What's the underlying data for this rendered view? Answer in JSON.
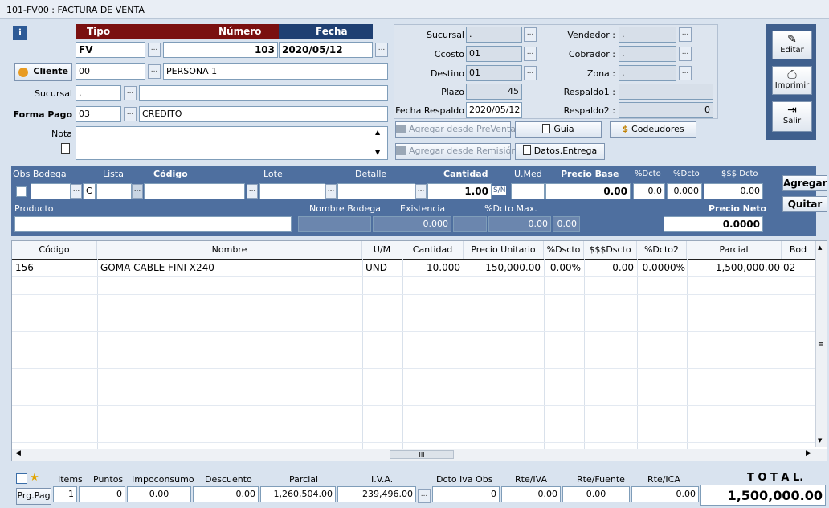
{
  "window": {
    "title": "101-FV00 : FACTURA DE VENTA"
  },
  "header": {
    "tipo_label": "Tipo",
    "numero_label": "Número",
    "fecha_label": "Fecha",
    "tipo": "FV",
    "numero": "103",
    "fecha": "2020/05/12",
    "cliente_label": "Cliente",
    "cliente_code": "00",
    "cliente_name": "PERSONA 1",
    "sucursal_label": "Sucursal",
    "sucursal_code": ".",
    "sucursal_name": "",
    "forma_pago_label": "Forma Pago",
    "forma_pago_code": "03",
    "forma_pago_name": "CREDITO",
    "nota_label": "Nota",
    "nota": ""
  },
  "info": {
    "sucursal_label": "Sucursal",
    "sucursal": ".",
    "ccosto_label": "Ccosto",
    "ccosto": "01",
    "destino_label": "Destino",
    "destino": "01",
    "plazo_label": "Plazo",
    "plazo": "45",
    "fecha_respaldo_label": "Fecha Respaldo",
    "fecha_respaldo": "2020/05/12",
    "vendedor_label": "Vendedor :",
    "vendedor": ".",
    "cobrador_label": "Cobrador :",
    "cobrador": ".",
    "zona_label": "Zona :",
    "zona": ".",
    "respaldo1_label": "Respaldo1 :",
    "respaldo1": "",
    "respaldo2_label": "Respaldo2 :",
    "respaldo2": "0"
  },
  "actions": {
    "agregar_preventa": "Agregar desde PreVenta",
    "agregar_remision": "Agregar desde Remisión-",
    "guia": "Guia",
    "datos_entrega": "Datos.Entrega",
    "codeudores": "Codeudores"
  },
  "side_buttons": {
    "editar": "Editar",
    "imprimir": "Imprimir",
    "salir": "Salir"
  },
  "detail": {
    "obs_bodega_label": "Obs Bodega",
    "lista_label": "Lista",
    "codigo_label": "Código",
    "lote_label": "Lote",
    "detalle_label": "Detalle",
    "cantidad_label": "Cantidad",
    "umed_label": "U.Med",
    "precio_base_label": "Precio Base",
    "dcto1_label": "%Dcto",
    "dcto2_label": "%Dcto",
    "dcto_money_label": "$$$ Dcto",
    "producto_label": "Producto",
    "nombre_bodega_label": "Nombre Bodega",
    "existencia_label": "Existencia",
    "dcto_max_label": "%Dcto Max.",
    "precio_neto_label": "Precio Neto",
    "lista_value": "C",
    "cantidad": "1.00",
    "sn": "S/N",
    "precio_base": "0.00",
    "dcto1": "0.0",
    "dcto2": "0.000",
    "dcto_money": "0.00",
    "existencia": "0.000",
    "dcto_max": "0.00",
    "dcto_max2": "0.00",
    "precio_neto": "0.0000",
    "agregar": "Agregar",
    "quitar": "Quitar"
  },
  "grid": {
    "columns": [
      "Código",
      "Nombre",
      "U/M",
      "Cantidad",
      "Precio Unitario",
      "%Dscto",
      "$$$Dscto",
      "%Dcto2",
      "Parcial",
      "Bod"
    ],
    "rows": [
      {
        "codigo": "156",
        "nombre": "GOMA CABLE FINI X240",
        "um": "UND",
        "cantidad": "10.000",
        "precio": "150,000.00",
        "dscto": "0.00%",
        "dscto_money": "0.00",
        "dcto2": "0.0000%",
        "parcial": "1,500,000.00",
        "bod": "02"
      }
    ],
    "scroll_mid": "III"
  },
  "footer": {
    "items_label": "Items",
    "puntos_label": "Puntos",
    "impoconsumo_label": "Impoconsumo",
    "descuento_label": "Descuento",
    "parcial_label": "Parcial",
    "iva_label": "I.V.A.",
    "dcto_iva_label": "Dcto Iva Obs",
    "rte_iva_label": "Rte/IVA",
    "rte_fuente_label": "Rte/Fuente",
    "rte_ica_label": "Rte/ICA",
    "total_label": "T O T A L.",
    "prg_pag": "Prg.Pag",
    "items": "1",
    "puntos": "0",
    "impoconsumo": "0.00",
    "descuento": "0.00",
    "parcial": "1,260,504.00",
    "iva": "239,496.00",
    "dcto_iva": "0",
    "rte_iva": "0.00",
    "rte_fuente": "0.00",
    "rte_ica": "0.00",
    "total": "1,500,000.00"
  },
  "colors": {
    "accent_dark_red": "#7a1010",
    "accent_navy": "#1e3f72",
    "panel_blue": "#4e6f9f"
  }
}
